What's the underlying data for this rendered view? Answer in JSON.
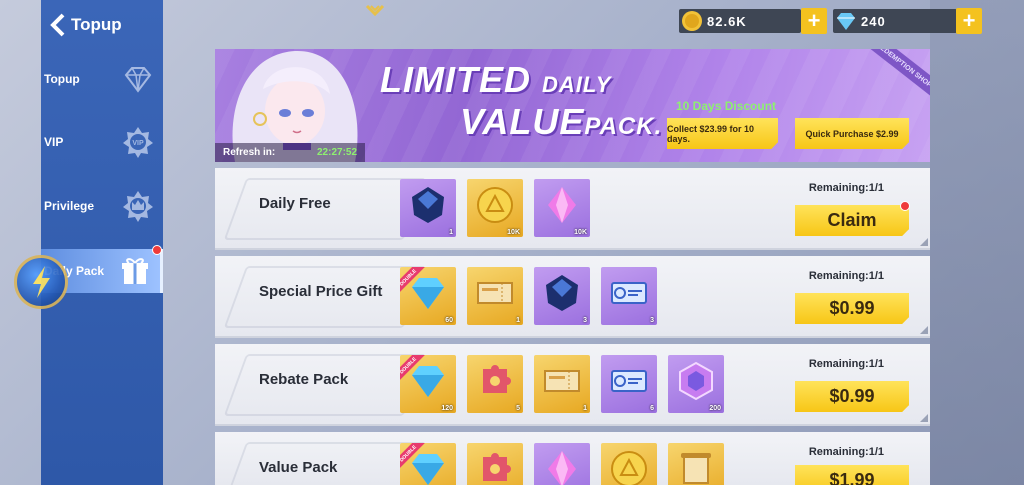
{
  "sidebar": {
    "title": "Topup",
    "items": [
      {
        "label": "Topup",
        "icon": "diamond-icon"
      },
      {
        "label": "VIP",
        "icon": "vip-badge-icon"
      },
      {
        "label": "Privilege",
        "icon": "crown-badge-icon"
      },
      {
        "label": "Daily Pack",
        "icon": "gift-icon",
        "active": true
      }
    ]
  },
  "currency": {
    "gold": "82.6K",
    "diamonds": "240"
  },
  "banner": {
    "title_limited": "LIMITED",
    "title_daily": "DAILY",
    "title_value": "VALUE",
    "title_pack": "PACK.",
    "discount": "10 Days Discount",
    "collect_button": "Collect $23.99 for 10 days.",
    "quick_button": "Quick Purchase $2.99",
    "refresh_label": "Refresh in:",
    "refresh_time": "22:27:52",
    "ribbon": "REDEMPTION SHOP"
  },
  "packs": [
    {
      "name": "Daily Free",
      "remaining": "Remaining:1/1",
      "button": "Claim",
      "has_dot": true,
      "items": [
        {
          "type": "purple",
          "icon": "dark-crystal-icon",
          "qty": "1"
        },
        {
          "type": "gold",
          "icon": "gold-coin-icon",
          "qty": "10K"
        },
        {
          "type": "purple",
          "icon": "pink-crystal-icon",
          "qty": "10K"
        }
      ]
    },
    {
      "name": "Special Price Gift",
      "remaining": "Remaining:1/1",
      "button": "$0.99",
      "items": [
        {
          "type": "gold",
          "icon": "diamond-icon",
          "qty": "60",
          "badge": "DOUBLE"
        },
        {
          "type": "gold",
          "icon": "ticket-icon",
          "qty": "1"
        },
        {
          "type": "purple",
          "icon": "dark-crystal-icon",
          "qty": "3"
        },
        {
          "type": "purple",
          "icon": "blue-ticket-icon",
          "qty": "3"
        }
      ]
    },
    {
      "name": "Rebate Pack",
      "remaining": "Remaining:1/1",
      "button": "$0.99",
      "items": [
        {
          "type": "gold",
          "icon": "diamond-icon",
          "qty": "120",
          "badge": "DOUBLE"
        },
        {
          "type": "gold",
          "icon": "puzzle-icon",
          "qty": "5"
        },
        {
          "type": "gold",
          "icon": "ticket-icon",
          "qty": "1"
        },
        {
          "type": "purple",
          "icon": "blue-ticket-icon",
          "qty": "6"
        },
        {
          "type": "purple",
          "icon": "hex-gem-icon",
          "qty": "200"
        }
      ]
    },
    {
      "name": "Value Pack",
      "remaining": "Remaining:1/1",
      "button": "$1.99",
      "items": [
        {
          "type": "gold",
          "icon": "diamond-icon",
          "qty": "",
          "badge": "DOUBLE"
        },
        {
          "type": "gold",
          "icon": "puzzle-icon",
          "qty": ""
        },
        {
          "type": "purple",
          "icon": "pink-crystal-icon",
          "qty": ""
        },
        {
          "type": "gold",
          "icon": "gold-coin-icon",
          "qty": ""
        },
        {
          "type": "gold",
          "icon": "scroll-icon",
          "qty": ""
        }
      ]
    }
  ],
  "colors": {
    "sidebar": "#3b66b8",
    "gold_button": "#f7c616",
    "banner": "#9367d4",
    "accent_green": "#8ef070"
  }
}
